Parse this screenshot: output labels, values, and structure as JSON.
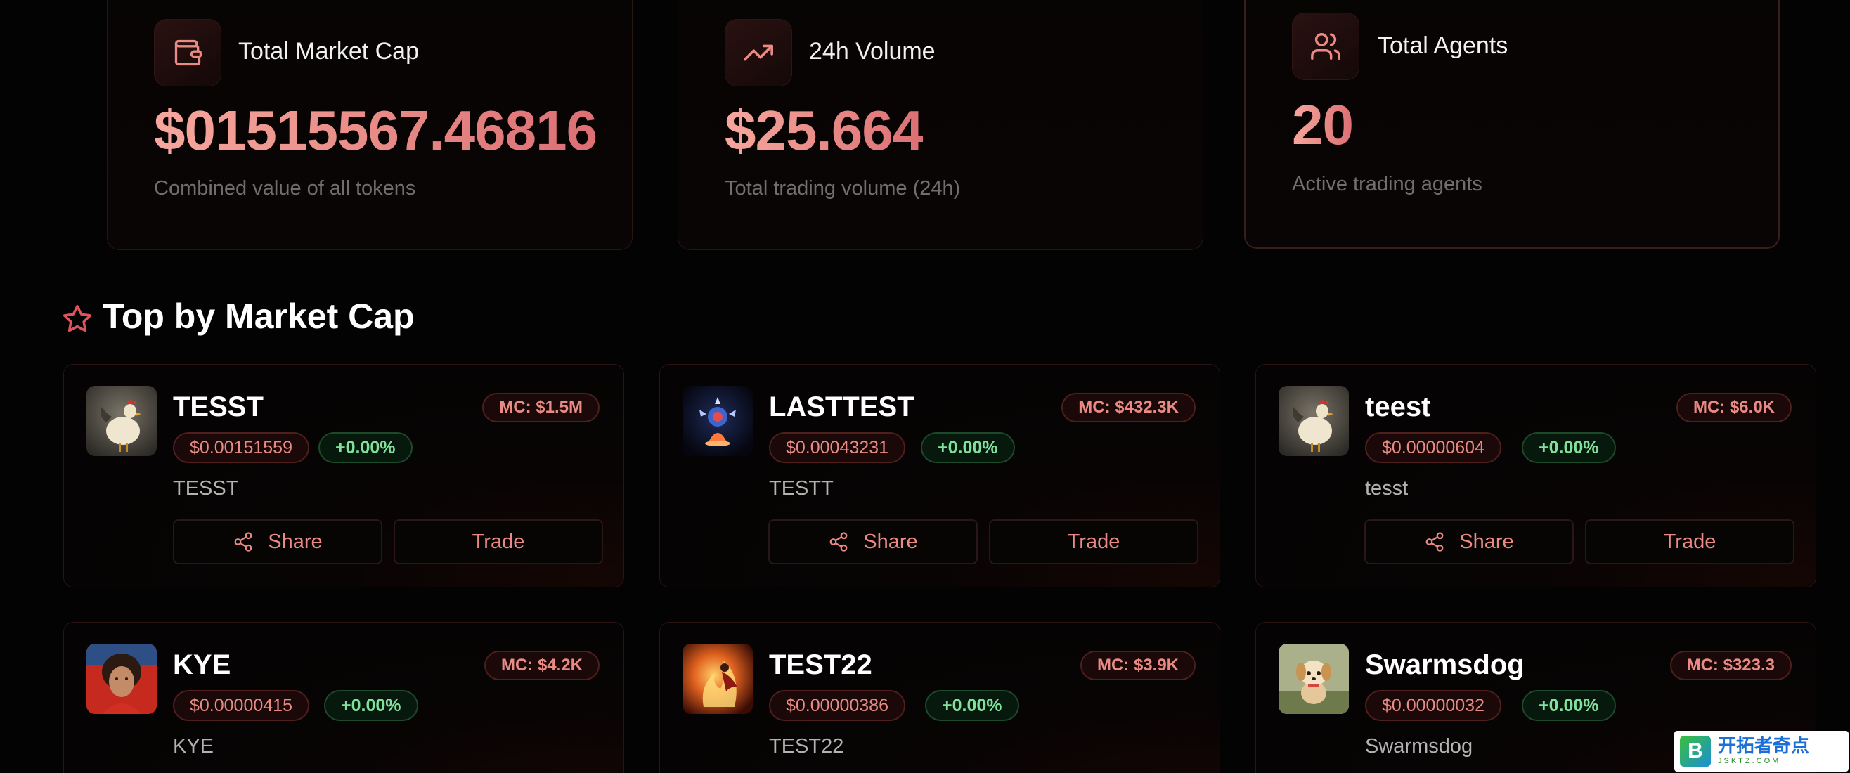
{
  "stats": [
    {
      "title": "Total Market Cap",
      "value": "$01515567.46816",
      "subtitle": "Combined value of all tokens",
      "icon": "wallet-icon"
    },
    {
      "title": "24h Volume",
      "value": "$25.664",
      "subtitle": "Total trading volume (24h)",
      "icon": "trending-up-icon"
    },
    {
      "title": "Total Agents",
      "value": "20",
      "subtitle": "Active trading agents",
      "icon": "users-icon"
    }
  ],
  "section": {
    "title": "Top by Market Cap",
    "icon": "star-icon"
  },
  "buttons": {
    "share": "Share",
    "trade": "Trade"
  },
  "tokens": [
    {
      "name": "TESST",
      "market_cap": "MC: $1.5M",
      "price": "$0.00151559",
      "change": "+0.00%",
      "symbol": "TESST",
      "avatar": "rooster-avatar"
    },
    {
      "name": "LASTTEST",
      "market_cap": "MC: $432.3K",
      "price": "$0.00043231",
      "change": "+0.00%",
      "symbol": "TESTT",
      "avatar": "crystal-avatar"
    },
    {
      "name": "teest",
      "market_cap": "MC: $6.0K",
      "price": "$0.00000604",
      "change": "+0.00%",
      "symbol": "tesst",
      "avatar": "rooster-avatar"
    },
    {
      "name": "KYE",
      "market_cap": "MC: $4.2K",
      "price": "$0.00000415",
      "change": "+0.00%",
      "symbol": "KYE",
      "avatar": "person-avatar"
    },
    {
      "name": "TEST22",
      "market_cap": "MC: $3.9K",
      "price": "$0.00000386",
      "change": "+0.00%",
      "symbol": "TEST22",
      "avatar": "fire-avatar"
    },
    {
      "name": "Swarmsdog",
      "market_cap": "MC: $323.3",
      "price": "$0.00000032",
      "change": "+0.00%",
      "symbol": "Swarmsdog",
      "avatar": "dog-avatar"
    }
  ],
  "colors": {
    "accent": "#e98a84",
    "positive": "#7fe19c",
    "background": "#030303"
  },
  "watermark": {
    "main": "开拓者奇点",
    "sub": "JSKTZ.COM",
    "logo": "B"
  }
}
